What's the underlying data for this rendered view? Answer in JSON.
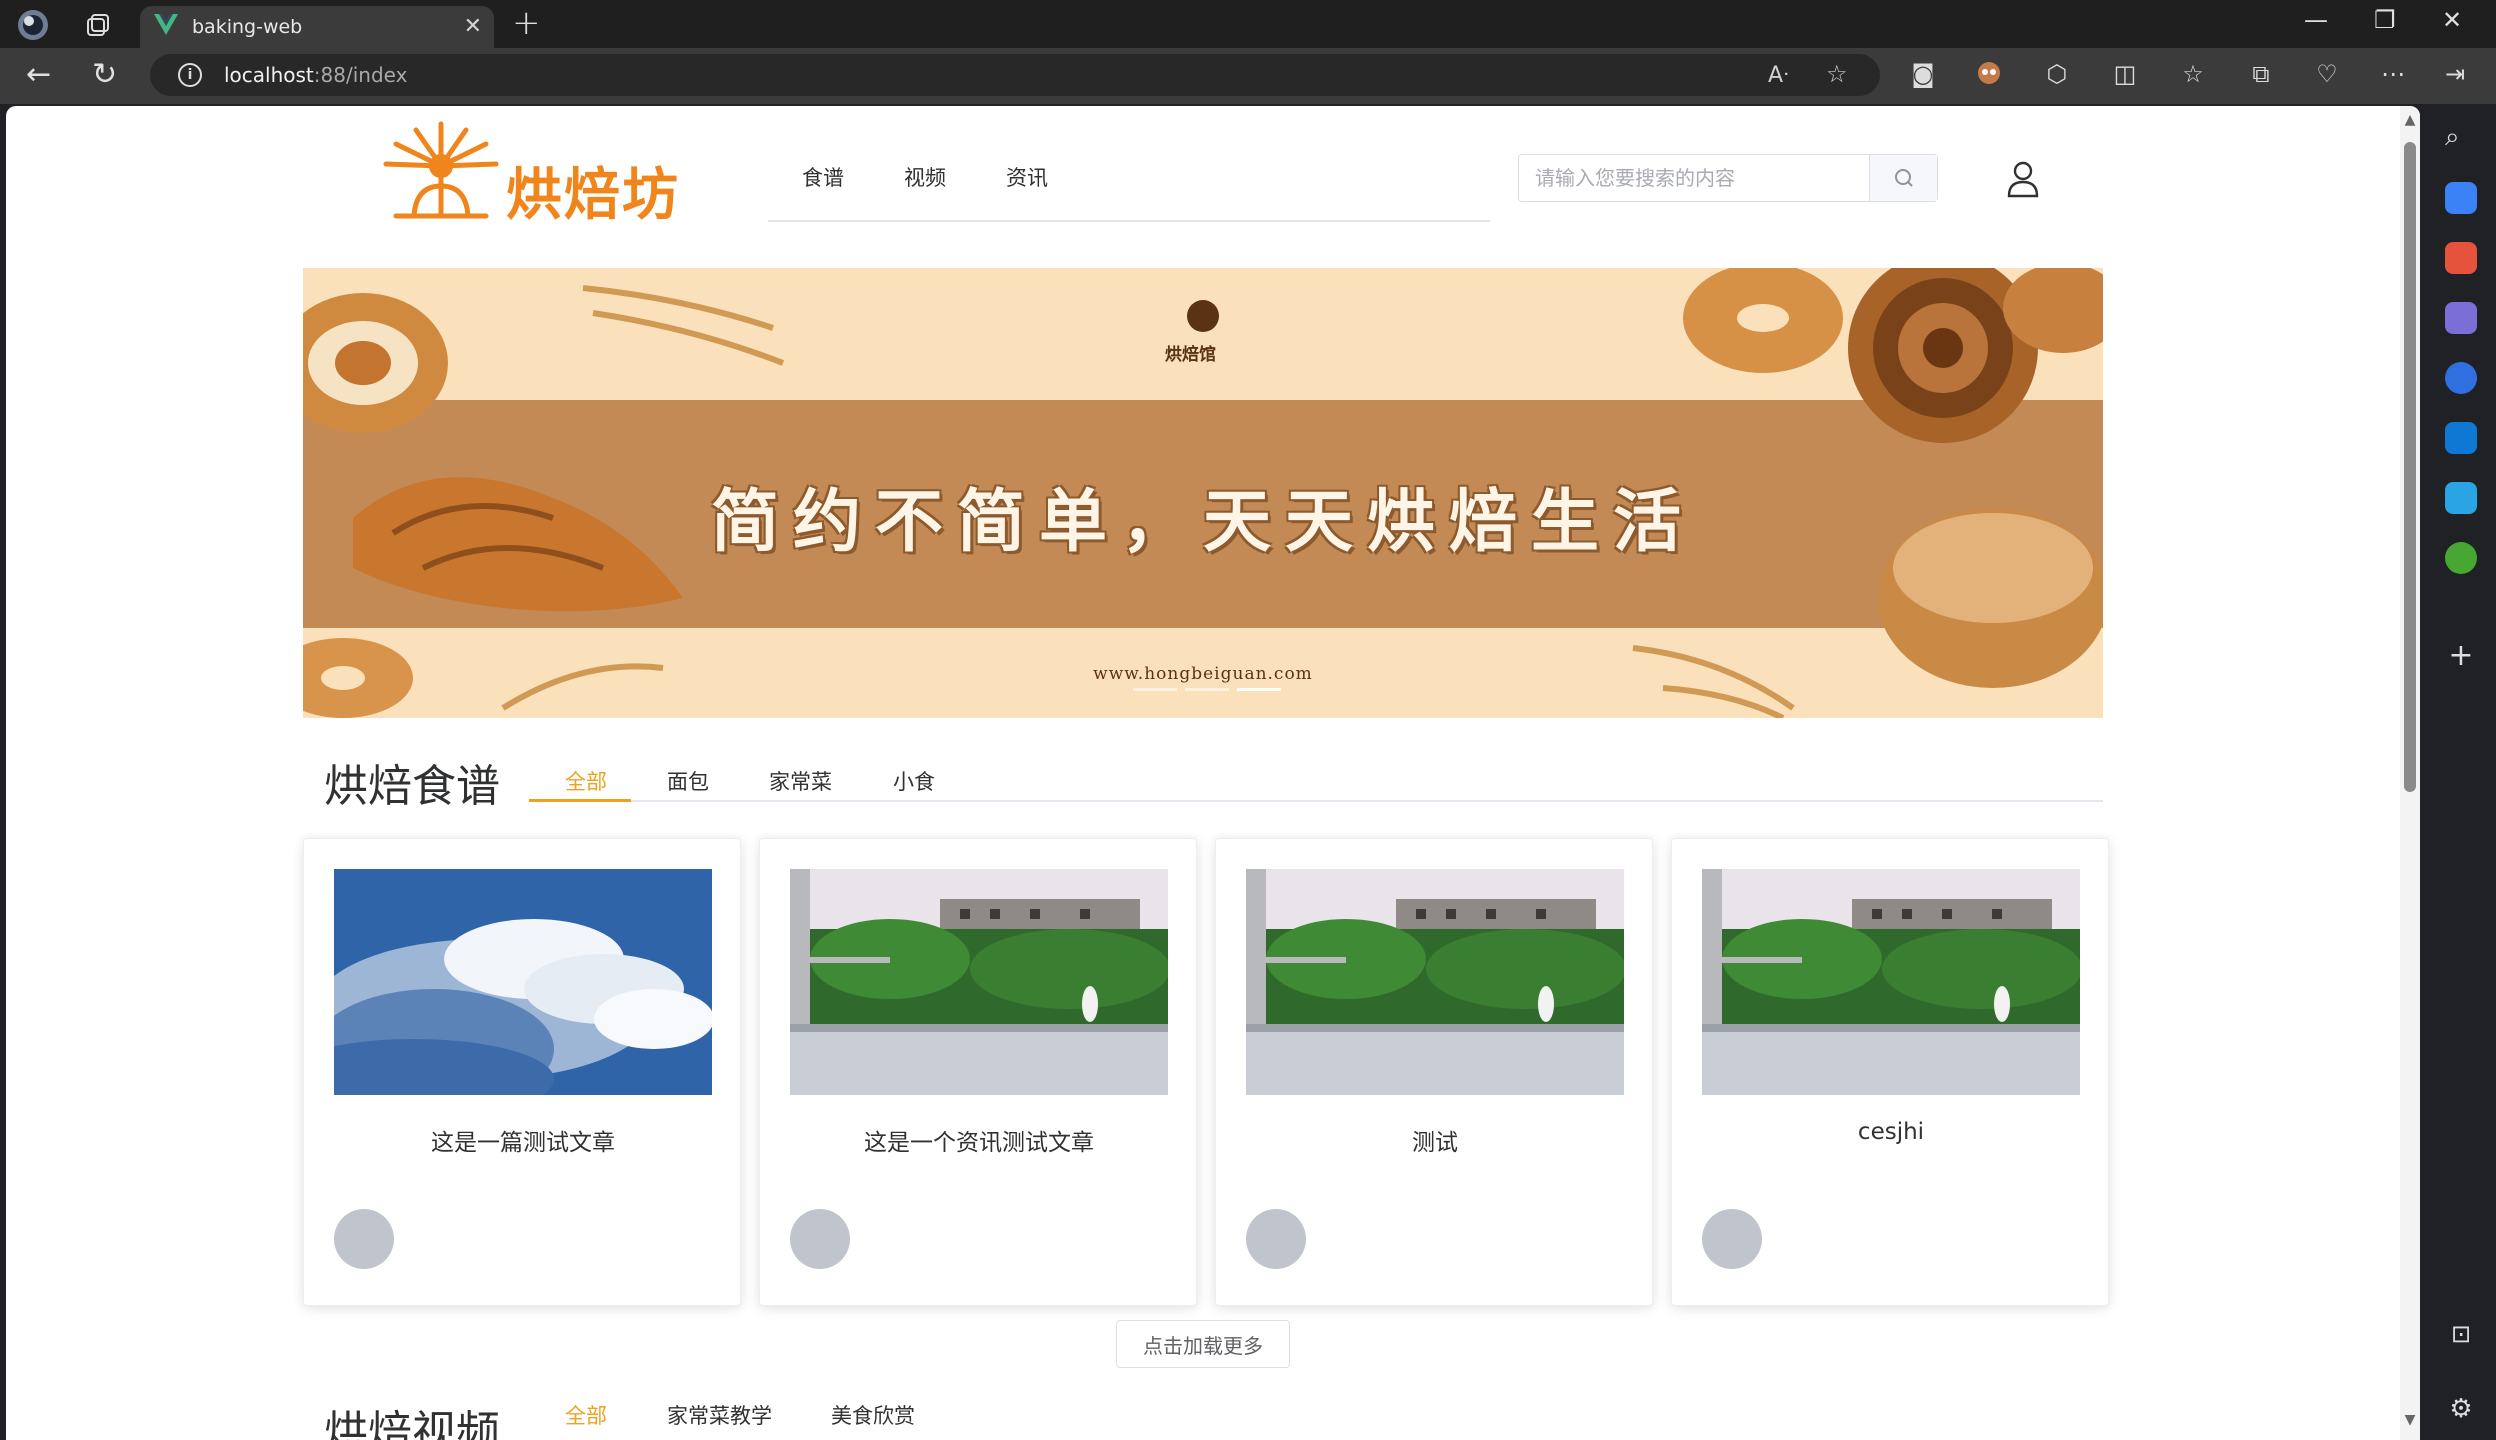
{
  "browser": {
    "tab_title": "baking-web",
    "url_host": "localhost",
    "url_path": ":88/index"
  },
  "header": {
    "logo_text": "烘焙坊",
    "nav": [
      "食谱",
      "视频",
      "资讯"
    ],
    "search_placeholder": "请输入您要搜索的内容"
  },
  "banner": {
    "brand": "烘焙馆",
    "slogan": "简约不简单，天天烘焙生活",
    "site": "www.hongbeiguan.com",
    "slides": 3,
    "active_slide": 3
  },
  "recipes": {
    "title": "烘焙食谱",
    "tabs": [
      "全部",
      "面包",
      "家常菜",
      "小食"
    ],
    "active_tab": "全部",
    "cards": [
      {
        "title": "这是一篇测试文章",
        "image": "sky-clouds"
      },
      {
        "title": "这是一个资讯测试文章",
        "image": "building-trees"
      },
      {
        "title": "测试",
        "image": "building-trees"
      },
      {
        "title": "cesjhi",
        "image": "building-trees"
      }
    ],
    "load_more": "点击加载更多"
  },
  "videos": {
    "title": "烘焙视频",
    "tabs": [
      "全部",
      "家常菜教学",
      "美食欣赏"
    ],
    "active_tab": "全部"
  },
  "colors": {
    "accent": "#f0a020",
    "logo": "#f0851b",
    "banner_band": "#c38a55"
  }
}
